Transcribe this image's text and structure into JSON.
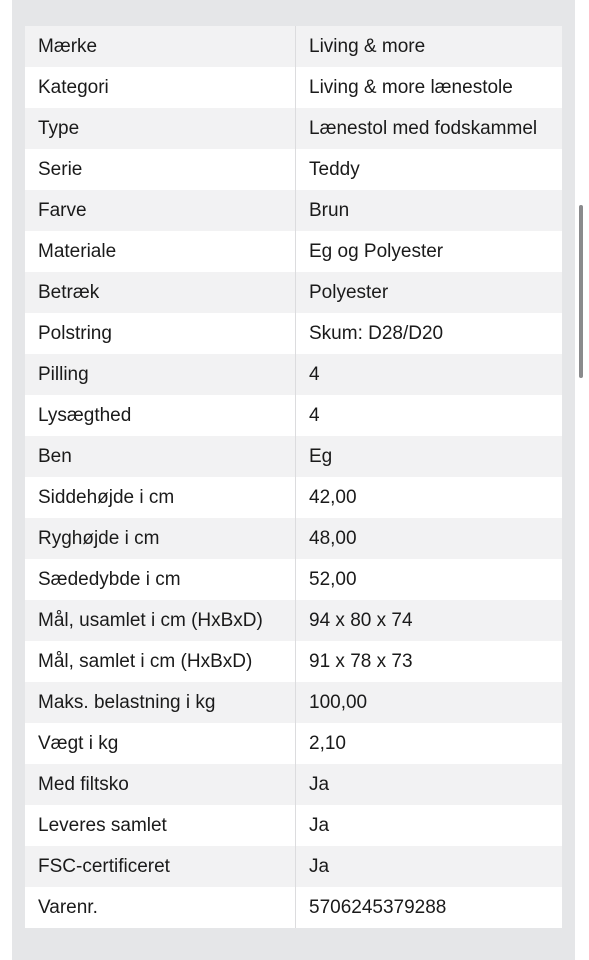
{
  "specs": {
    "rows": [
      {
        "label": "Mærke",
        "value": "Living & more"
      },
      {
        "label": "Kategori",
        "value": "Living & more lænestole"
      },
      {
        "label": "Type",
        "value": "Lænestol med fodskammel"
      },
      {
        "label": "Serie",
        "value": "Teddy"
      },
      {
        "label": "Farve",
        "value": "Brun"
      },
      {
        "label": "Materiale",
        "value": "Eg og Polyester"
      },
      {
        "label": "Betræk",
        "value": "Polyester"
      },
      {
        "label": "Polstring",
        "value": "Skum: D28/D20"
      },
      {
        "label": "Pilling",
        "value": "4"
      },
      {
        "label": "Lysægthed",
        "value": "4"
      },
      {
        "label": "Ben",
        "value": "Eg"
      },
      {
        "label": "Siddehøjde i cm",
        "value": "42,00"
      },
      {
        "label": "Ryghøjde i cm",
        "value": "48,00"
      },
      {
        "label": "Sædedybde i cm",
        "value": "52,00"
      },
      {
        "label": "Mål, usamlet i cm (HxBxD)",
        "value": "94 x 80 x 74"
      },
      {
        "label": "Mål, samlet i cm (HxBxD)",
        "value": "91 x 78 x 73"
      },
      {
        "label": "Maks. belastning i kg",
        "value": "100,00"
      },
      {
        "label": "Vægt i kg",
        "value": "2,10"
      },
      {
        "label": "Med filtsko",
        "value": "Ja"
      },
      {
        "label": "Leveres samlet",
        "value": "Ja"
      },
      {
        "label": "FSC-certificeret",
        "value": "Ja"
      },
      {
        "label": "Varenr.",
        "value": "5706245379288"
      }
    ]
  }
}
